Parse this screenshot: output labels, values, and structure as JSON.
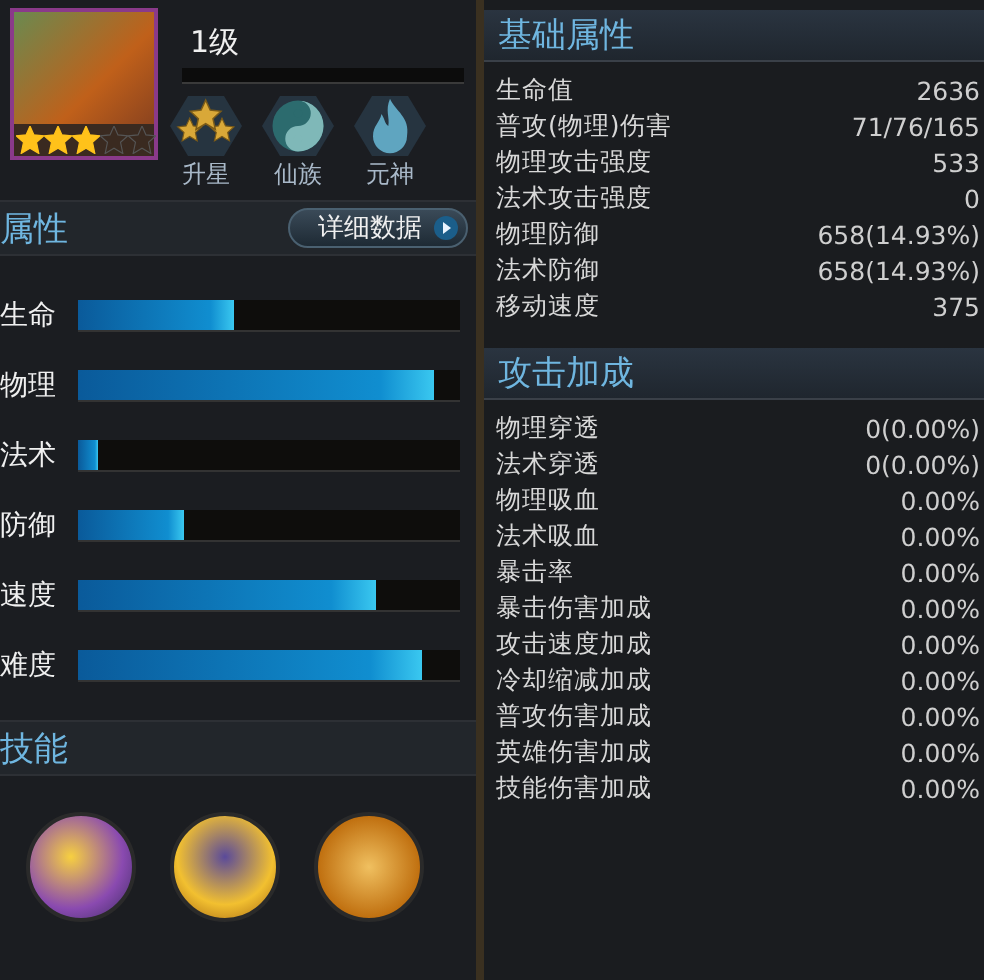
{
  "hero": {
    "stars": 3,
    "level": "1级",
    "actions": [
      {
        "kind": "stars",
        "label": "升星"
      },
      {
        "kind": "yinyang",
        "label": "仙族"
      },
      {
        "kind": "flame",
        "label": "元神"
      }
    ]
  },
  "attributes": {
    "title": "属性",
    "detail_button": "详细数据",
    "bars": [
      {
        "label": "生命",
        "level": 0.41
      },
      {
        "label": "物理",
        "level": 0.93
      },
      {
        "label": "法术",
        "level": 0.05
      },
      {
        "label": "防御",
        "level": 0.28
      },
      {
        "label": "速度",
        "level": 0.78
      },
      {
        "label": "难度",
        "level": 0.9
      }
    ]
  },
  "skills": {
    "title": "技能"
  },
  "base_stats": {
    "title": "基础属性",
    "rows": [
      {
        "name": "生命值",
        "value": "2636"
      },
      {
        "name": "普攻(物理)伤害",
        "value": "71/76/165"
      },
      {
        "name": "物理攻击强度",
        "value": "533"
      },
      {
        "name": "法术攻击强度",
        "value": "0"
      },
      {
        "name": "物理防御",
        "value": "658(14.93%)"
      },
      {
        "name": "法术防御",
        "value": "658(14.93%)"
      },
      {
        "name": "移动速度",
        "value": "375"
      }
    ]
  },
  "attack_bonus": {
    "title": "攻击加成",
    "rows": [
      {
        "name": "物理穿透",
        "value": "0(0.00%)"
      },
      {
        "name": "法术穿透",
        "value": "0(0.00%)"
      },
      {
        "name": "物理吸血",
        "value": "0.00%"
      },
      {
        "name": "法术吸血",
        "value": "0.00%"
      },
      {
        "name": "暴击率",
        "value": "0.00%"
      },
      {
        "name": "暴击伤害加成",
        "value": "0.00%"
      },
      {
        "name": "攻击速度加成",
        "value": "0.00%"
      },
      {
        "name": "冷却缩减加成",
        "value": "0.00%"
      },
      {
        "name": "普攻伤害加成",
        "value": "0.00%"
      },
      {
        "name": "英雄伤害加成",
        "value": "0.00%"
      },
      {
        "name": "技能伤害加成",
        "value": "0.00%"
      }
    ]
  }
}
